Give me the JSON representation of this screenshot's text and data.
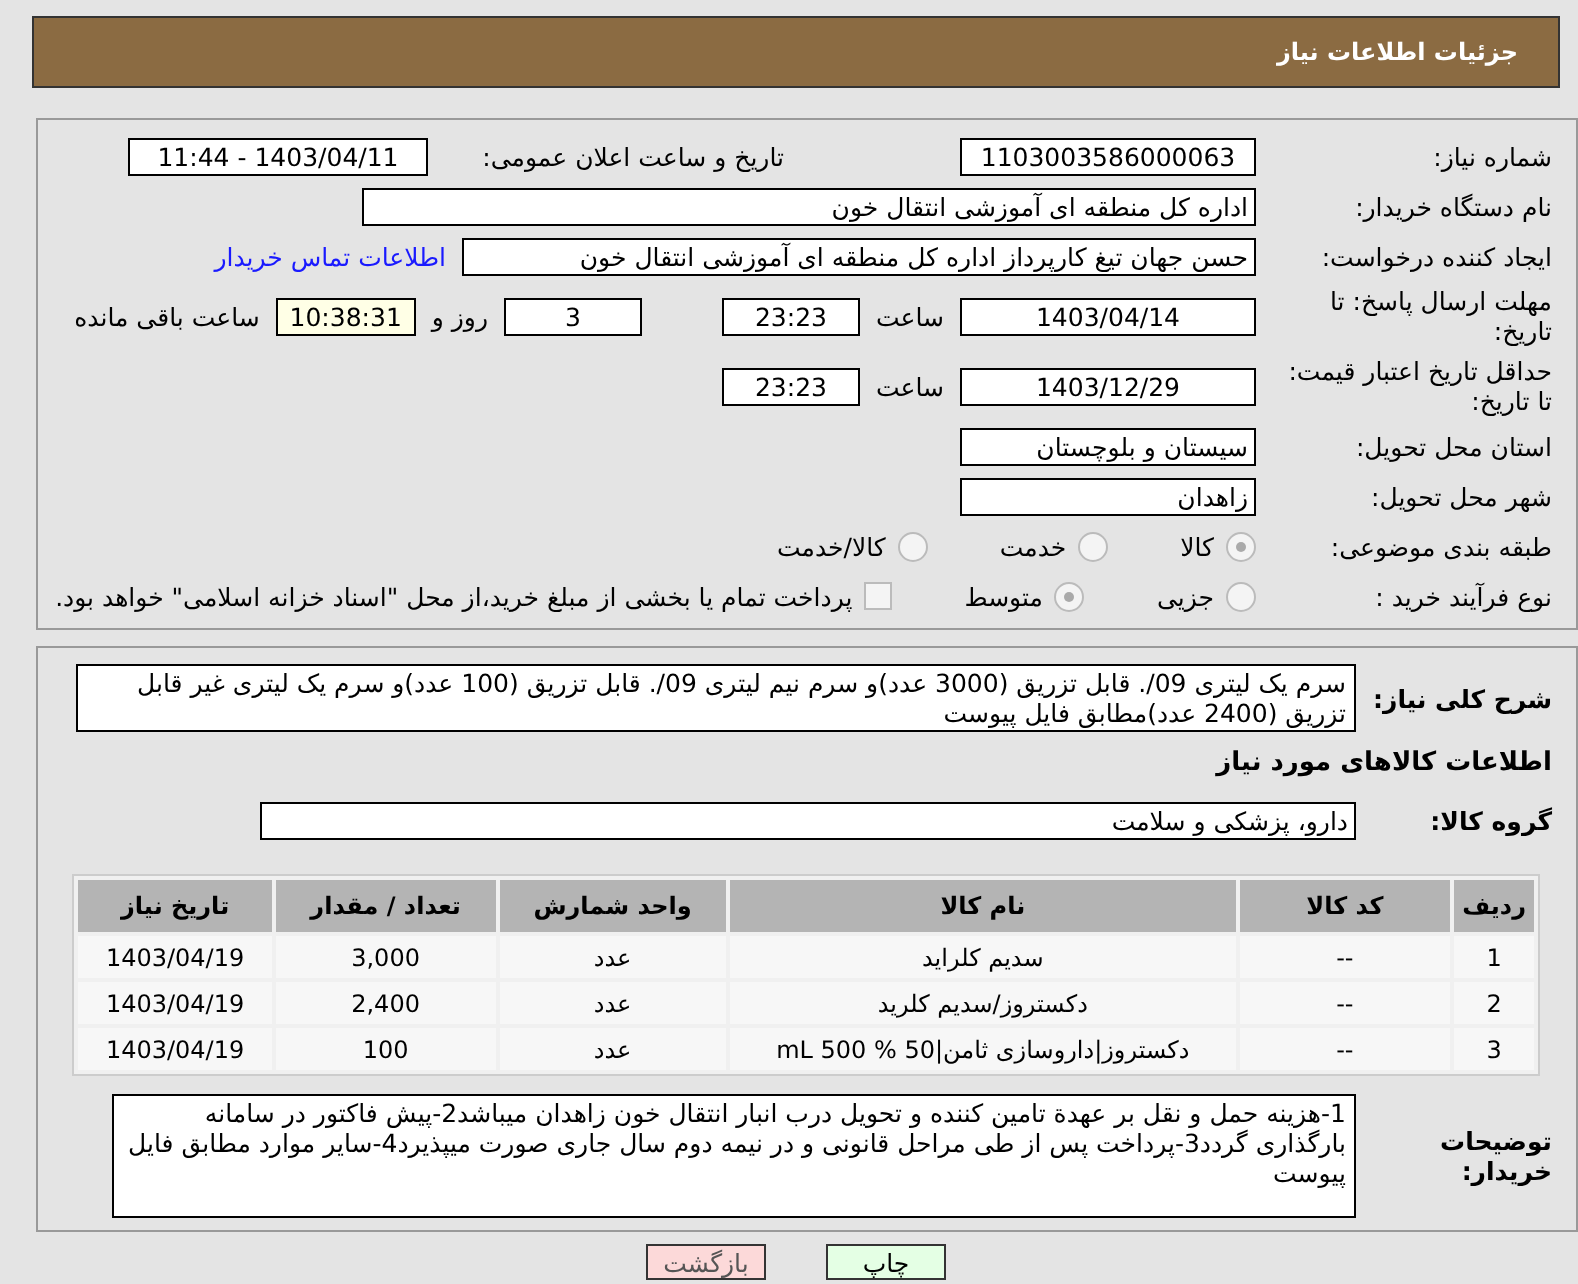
{
  "header": {
    "title": "جزئیات اطلاعات نیاز"
  },
  "need_number": {
    "label": "شماره نیاز:",
    "value": "1103003586000063"
  },
  "announce": {
    "label": "تاریخ و ساعت اعلان عمومی:",
    "value": "1403/04/11 - 11:44"
  },
  "buyer_org": {
    "label": "نام دستگاه خریدار:",
    "value": "اداره کل منطقه ای آموزشی انتقال خون"
  },
  "requester": {
    "label": "ایجاد کننده درخواست:",
    "value": "حسن جهان تیغ کارپرداز اداره کل منطقه ای آموزشی انتقال خون",
    "link": "اطلاعات تماس خریدار"
  },
  "reply_deadline": {
    "label": "مهلت ارسال پاسخ: تا تاریخ:",
    "date": "1403/04/14",
    "time_label": "ساعت",
    "time": "23:23",
    "days": "3",
    "days_label": "روز و",
    "remaining": "10:38:31",
    "remaining_label": "ساعت باقی مانده"
  },
  "price_validity": {
    "label": "حداقل تاریخ اعتبار قیمت: تا تاریخ:",
    "date": "1403/12/29",
    "time_label": "ساعت",
    "time": "23:23"
  },
  "province": {
    "label": "استان محل تحویل:",
    "value": "سیستان و بلوچستان"
  },
  "city": {
    "label": "شهر محل تحویل:",
    "value": "زاهدان"
  },
  "category": {
    "label": "طبقه بندی موضوعی:",
    "options": [
      {
        "label": "کالا",
        "selected": true
      },
      {
        "label": "خدمت",
        "selected": false
      },
      {
        "label": "کالا/خدمت",
        "selected": false
      }
    ]
  },
  "purchase_type": {
    "label": "نوع فرآیند خرید :",
    "options": [
      {
        "label": "جزیی",
        "selected": false
      },
      {
        "label": "متوسط",
        "selected": true
      }
    ],
    "payment_checkbox": {
      "checked": false,
      "label": "پرداخت تمام یا بخشی از مبلغ خرید،از محل \"اسناد خزانه اسلامی\" خواهد بود."
    }
  },
  "summary": {
    "label": "شرح کلی نیاز:",
    "value": "سرم یک لیتری 09/. قابل تزریق (3000 عدد)و سرم نیم لیتری 09/. قابل تزریق (100 عدد)و سرم یک لیتری غیر قابل تزریق (2400 عدد)مطابق فایل پیوست"
  },
  "goods_heading": "اطلاعات کالاهای مورد نیاز",
  "goods_group": {
    "label": "گروه کالا:",
    "value": "دارو، پزشکی و سلامت"
  },
  "table": {
    "columns": [
      "ردیف",
      "کد کالا",
      "نام کالا",
      "واحد شمارش",
      "تعداد / مقدار",
      "تاریخ نیاز"
    ],
    "rows": [
      [
        "1",
        "--",
        "سدیم کلراید",
        "عدد",
        "3,000",
        "1403/04/19"
      ],
      [
        "2",
        "--",
        "دکستروز/سدیم کلرید",
        "عدد",
        "2,400",
        "1403/04/19"
      ],
      [
        "3",
        "--",
        "دکستروز|داروسازی ثامن|50 % 500 mL",
        "عدد",
        "100",
        "1403/04/19"
      ]
    ]
  },
  "buyer_notes": {
    "label": "توضیحات خریدار:",
    "value": "1-هزینه حمل و نقل بر عهدة تامین کننده و تحویل درب انبار انتقال خون زاهدان میباشد2-پیش فاکتور در سامانه بارگذاری گردد3-پرداخت پس از طی مراحل قانونی و در نیمه دوم سال جاری صورت میپذیرد4-سایر موارد مطابق فایل پیوست"
  },
  "buttons": [
    {
      "label": "چاپ",
      "kind": "print"
    },
    {
      "label": "بازگشت",
      "kind": "back"
    }
  ]
}
